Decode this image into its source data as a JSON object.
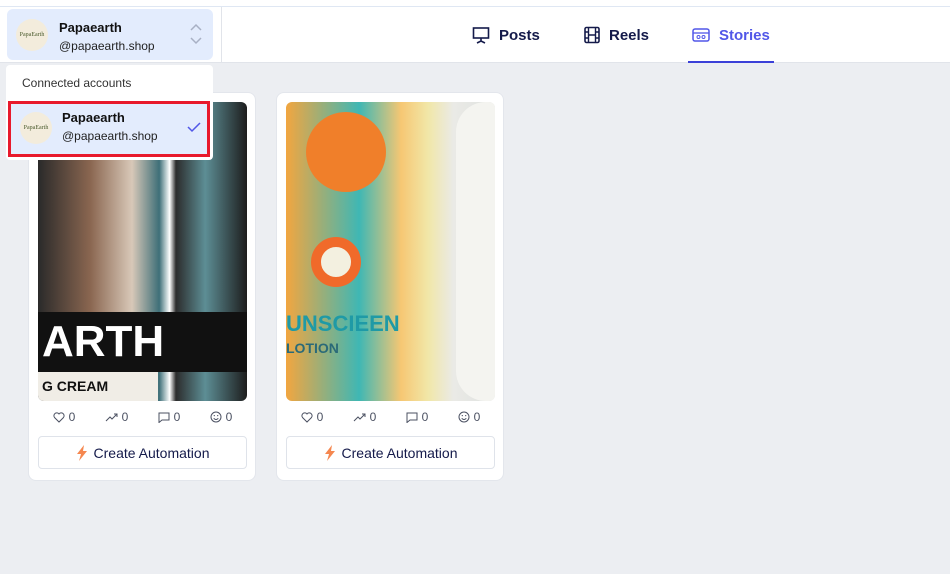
{
  "account": {
    "name": "Papaearth",
    "handle": "@papaearth.shop",
    "avatar_text": "PapaEarth"
  },
  "tabs": [
    {
      "label": "Posts",
      "icon": "presentation-icon"
    },
    {
      "label": "Reels",
      "icon": "film-icon"
    },
    {
      "label": "Stories",
      "icon": "stories-icon",
      "active": true
    }
  ],
  "dropdown": {
    "title": "Connected accounts",
    "items": [
      {
        "name": "Papaearth",
        "handle": "@papaearth.shop",
        "selected": true
      }
    ]
  },
  "cards": [
    {
      "image_lettering": "ARTH G CREAM",
      "likes": "0",
      "shares": "0",
      "comments": "0",
      "reactions": "0",
      "button": "Create Automation"
    },
    {
      "image_lettering": "UNSCIEEN LOTION",
      "likes": "0",
      "shares": "0",
      "comments": "0",
      "reactions": "0",
      "button": "Create Automation"
    }
  ],
  "colors": {
    "accent": "#5157e8",
    "highlight": "#e8192c",
    "selected_bg": "#e3ecfd",
    "bolt": "#f5874f"
  }
}
